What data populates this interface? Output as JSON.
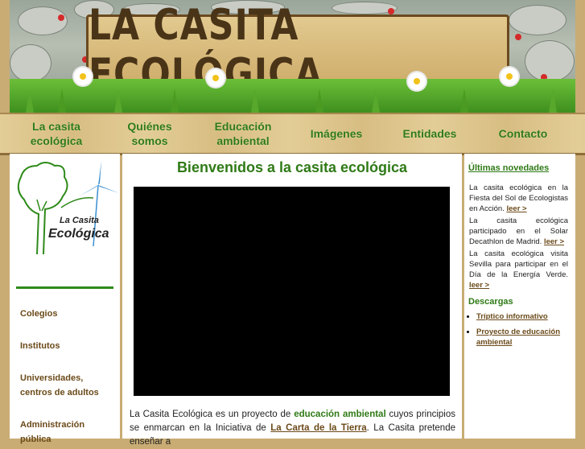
{
  "header": {
    "site_title": "LA CASITA ECOLÓGICA"
  },
  "nav": {
    "items": [
      {
        "label": "La casita\necológica"
      },
      {
        "label": "Quiénes\nsomos"
      },
      {
        "label": "Educación\nambiental"
      },
      {
        "label": "Imágenes"
      },
      {
        "label": "Entidades"
      },
      {
        "label": "Contacto"
      }
    ]
  },
  "sidebar": {
    "logo_line1": "La Casita",
    "logo_line2": "Ecológica",
    "links": [
      {
        "label": "Colegios"
      },
      {
        "label": "Institutos"
      },
      {
        "label": "Universidades,\ncentros de adultos"
      },
      {
        "label": "Administración\npública"
      }
    ]
  },
  "main": {
    "title": "Bienvenidos a la casita ecológica",
    "para_1": "La Casita Ecológica es un proyecto de ",
    "para_link_1": "educación ambiental",
    "para_2": " cuyos principios se enmarcan en la Iniciativa de ",
    "para_link_2": "La Carta de la Tierra",
    "para_3": ". La Casita pretende enseñar a"
  },
  "right": {
    "news_heading": "Últimas novedades",
    "news": [
      {
        "text": "La casita ecológica en la Fiesta del Sol de Ecologistas en Acción.",
        "more": "leer >"
      },
      {
        "text": "La casita ecológica participado en el Solar Decathlon de Madrid.",
        "more": "leer >"
      },
      {
        "text": "La casita ecológica visita Sevilla para participar en el Día de la Energía Verde.",
        "more": "leer >"
      }
    ],
    "downloads_heading": "Descargas",
    "downloads": [
      {
        "label": "Tríptico informativo"
      },
      {
        "label": "Proyecto de educación ambiental"
      }
    ]
  },
  "colors": {
    "green": "#2f7a16",
    "brown_link": "#6b4a1a",
    "wood": "#c9ac74"
  }
}
